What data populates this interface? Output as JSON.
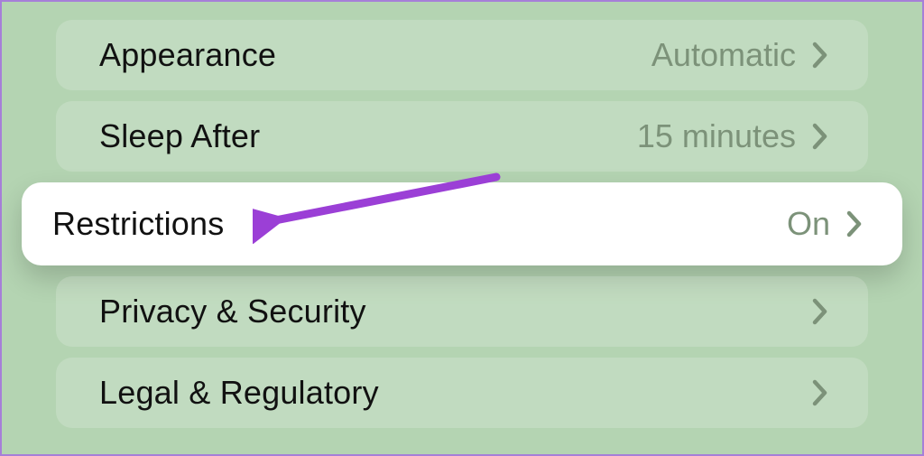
{
  "settings": {
    "items": [
      {
        "label": "Appearance",
        "value": "Automatic",
        "highlighted": false
      },
      {
        "label": "Sleep After",
        "value": "15 minutes",
        "highlighted": false
      },
      {
        "label": "Restrictions",
        "value": "On",
        "highlighted": true
      },
      {
        "label": "Privacy & Security",
        "value": "",
        "highlighted": false
      },
      {
        "label": "Legal & Regulatory",
        "value": "",
        "highlighted": false
      }
    ]
  },
  "colors": {
    "background": "#b4d4b2",
    "border": "#a67fd8",
    "value_text": "#7c9279",
    "chevron": "#7c9279",
    "annotation_arrow": "#9b3fd6",
    "highlight_bg": "#ffffff"
  }
}
